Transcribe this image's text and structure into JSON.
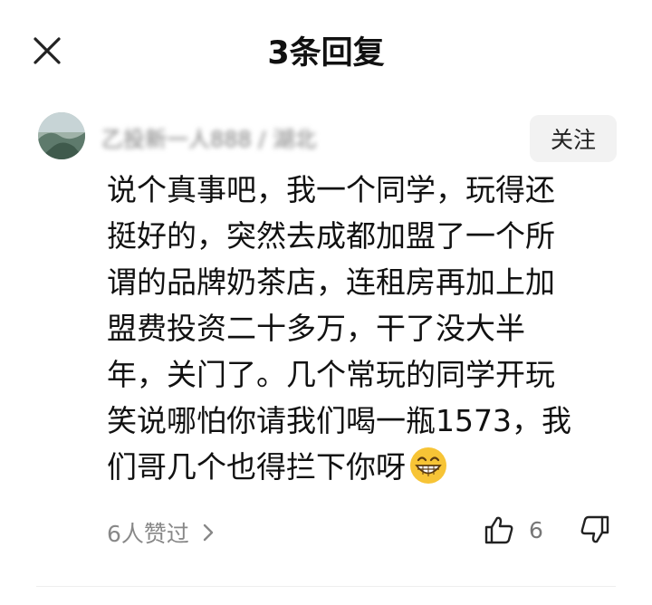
{
  "header": {
    "title": "3条回复"
  },
  "comment": {
    "username": "乙投新一人888 / 湖北",
    "follow_label": "关注",
    "lines": [
      "说个真事吧，我一个同学，玩得还",
      "挺好的，突然去成都加盟了一个所",
      "谓的品牌奶茶店，连租房再加上加",
      "盟费投资二十多万，干了没大半",
      "年，关门了。几个常玩的同学开玩",
      "笑说哪怕你请我们喝一瓶1573，我",
      "们哥几个也得拦下你呀"
    ],
    "emoji": "grinning-face-emoji"
  },
  "footer": {
    "likes_summary": "6人赞过",
    "like_count": "6"
  },
  "icons": {
    "close": "close-icon",
    "chevron": "chevron-right-icon",
    "thumbs_up": "thumbs-up-icon",
    "thumbs_down": "thumbs-down-icon"
  },
  "colors": {
    "text": "#111111",
    "muted": "#888888",
    "follow_bg": "#f2f2f2",
    "emoji_yellow": "#f7c436"
  }
}
